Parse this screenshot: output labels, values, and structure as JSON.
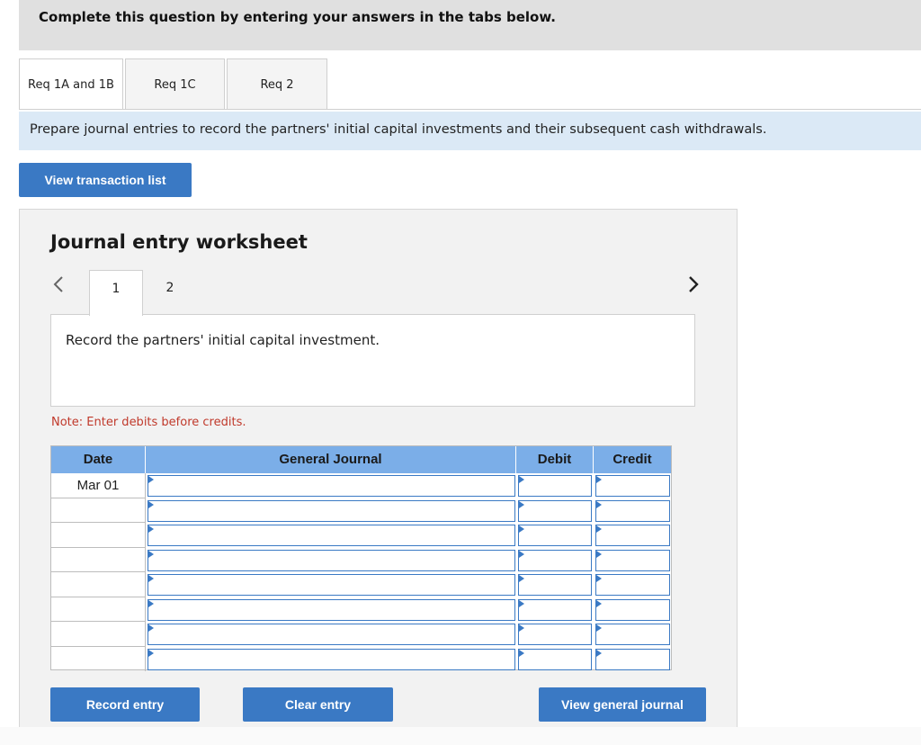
{
  "header": {
    "instruction": "Complete this question by entering your answers in the tabs below."
  },
  "tabs": [
    {
      "label": "Req 1A and 1B"
    },
    {
      "label": "Req 1C"
    },
    {
      "label": "Req 2"
    }
  ],
  "prompt": "Prepare journal entries to record the partners' initial capital investments and their subsequent cash withdrawals.",
  "view_transaction_list_label": "View transaction list",
  "worksheet": {
    "title": "Journal entry worksheet",
    "steps": [
      "1",
      "2"
    ],
    "description": "Record the partners' initial capital investment.",
    "note": "Note: Enter debits before credits.",
    "columns": {
      "date": "Date",
      "general_journal": "General Journal",
      "debit": "Debit",
      "credit": "Credit"
    },
    "rows": [
      {
        "date": "Mar 01"
      },
      {
        "date": ""
      },
      {
        "date": ""
      },
      {
        "date": ""
      },
      {
        "date": ""
      },
      {
        "date": ""
      },
      {
        "date": ""
      },
      {
        "date": ""
      }
    ],
    "buttons": {
      "record": "Record entry",
      "clear": "Clear entry",
      "view_general": "View general journal"
    }
  },
  "colors": {
    "primary_button": "#3a79c4",
    "table_header": "#7baee8",
    "prompt_bg": "#dbe9f6",
    "note_text": "#c0392b"
  },
  "icons": {
    "prev": "chevron-left-icon",
    "next": "chevron-right-icon"
  }
}
